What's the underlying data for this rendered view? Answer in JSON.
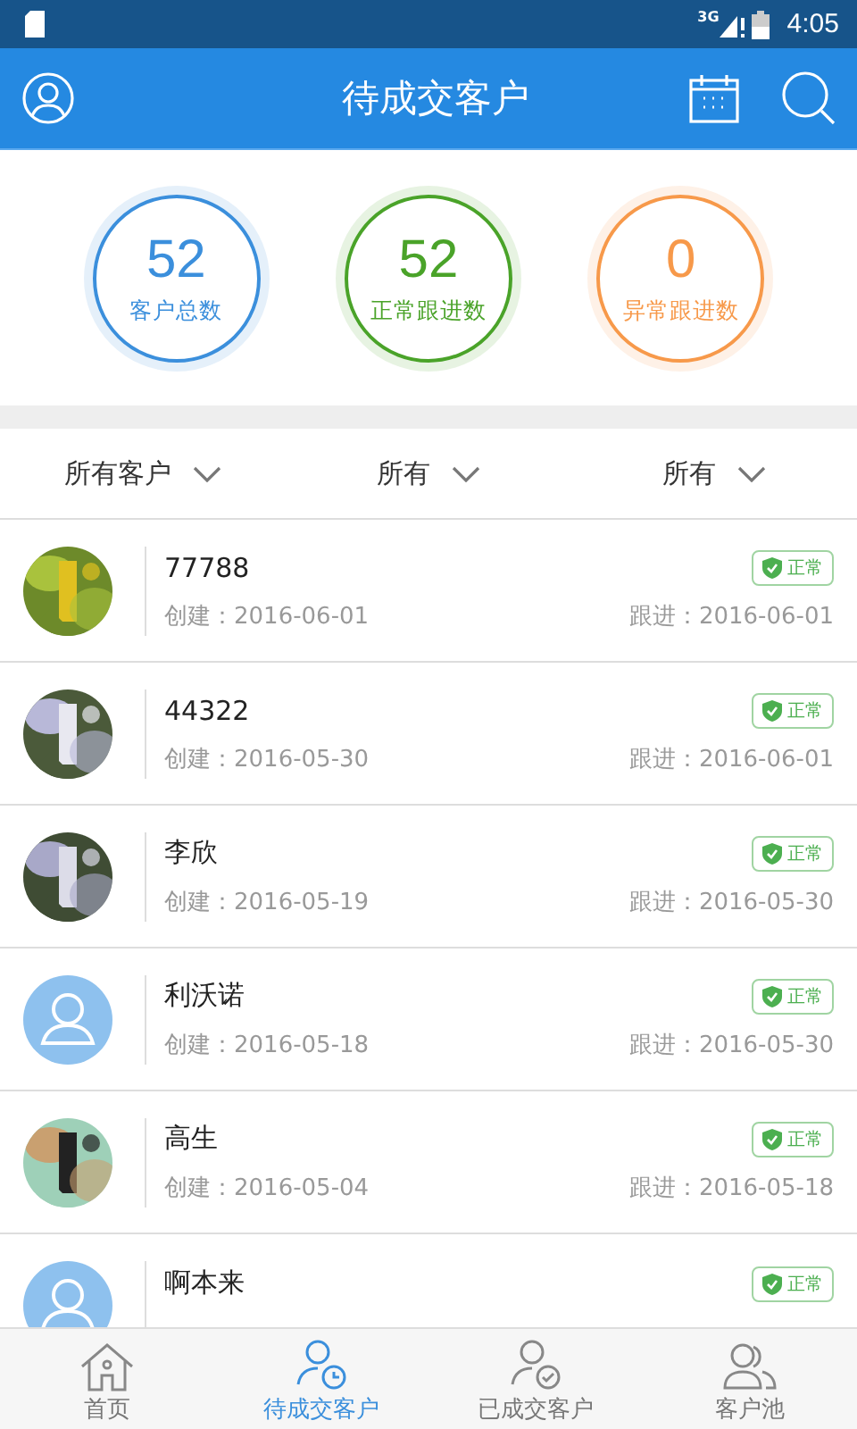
{
  "status_bar": {
    "network": "3G",
    "time": "4:05"
  },
  "header": {
    "title": "待成交客户"
  },
  "stats": [
    {
      "value": "52",
      "label": "客户总数",
      "color": "#3b8fdc"
    },
    {
      "value": "52",
      "label": "正常跟进数",
      "color": "#4aa329"
    },
    {
      "value": "0",
      "label": "异常跟进数",
      "color": "#f7994a"
    }
  ],
  "filters": [
    {
      "label": "所有客户"
    },
    {
      "label": "所有"
    },
    {
      "label": "所有"
    }
  ],
  "customers": [
    {
      "name": "77788",
      "kind": "picture",
      "status_label": "正常",
      "created": "创建：2016-06-01",
      "followed": "跟进：2016-06-01"
    },
    {
      "name": "44322",
      "kind": "picture",
      "status_label": "正常",
      "created": "创建：2016-05-30",
      "followed": "跟进：2016-06-01"
    },
    {
      "name": "李欣",
      "kind": "picture",
      "status_label": "正常",
      "created": "创建：2016-05-19",
      "followed": "跟进：2016-05-30"
    },
    {
      "name": "利沃诺",
      "kind": "default",
      "status_label": "正常",
      "created": "创建：2016-05-18",
      "followed": "跟进：2016-05-30"
    },
    {
      "name": "高生",
      "kind": "picture",
      "status_label": "正常",
      "created": "创建：2016-05-04",
      "followed": "跟进：2016-05-18"
    },
    {
      "name": "啊本来",
      "kind": "default",
      "status_label": "正常"
    }
  ],
  "tabs": [
    {
      "label": "首页",
      "selected": false
    },
    {
      "label": "待成交客户",
      "selected": true
    },
    {
      "label": "已成交客户",
      "selected": false
    },
    {
      "label": "客户池",
      "selected": false
    }
  ]
}
